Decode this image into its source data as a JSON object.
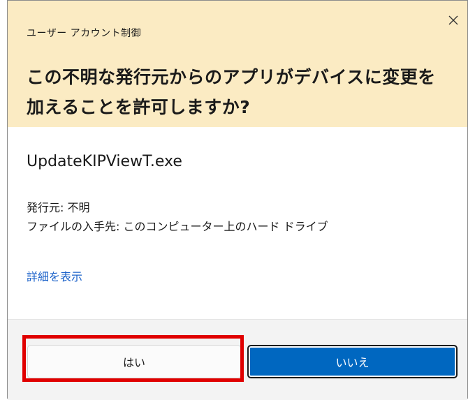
{
  "dialog": {
    "caption": "ユーザー アカウント制御",
    "close_icon": "close-icon",
    "question": "この不明な発行元からのアプリがデバイスに変更を加えることを許可しますか?",
    "program_name": "UpdateKIPViewT.exe",
    "publisher_label": "発行元: 不明",
    "origin_label": "ファイルの入手先: このコンピューター上のハード ドライブ",
    "details_link": "詳細を表示",
    "yes_button": "はい",
    "no_button": "いいえ",
    "header_color": "#fbebc3",
    "accent_color": "#0067c0",
    "highlight_color": "#e00000"
  }
}
